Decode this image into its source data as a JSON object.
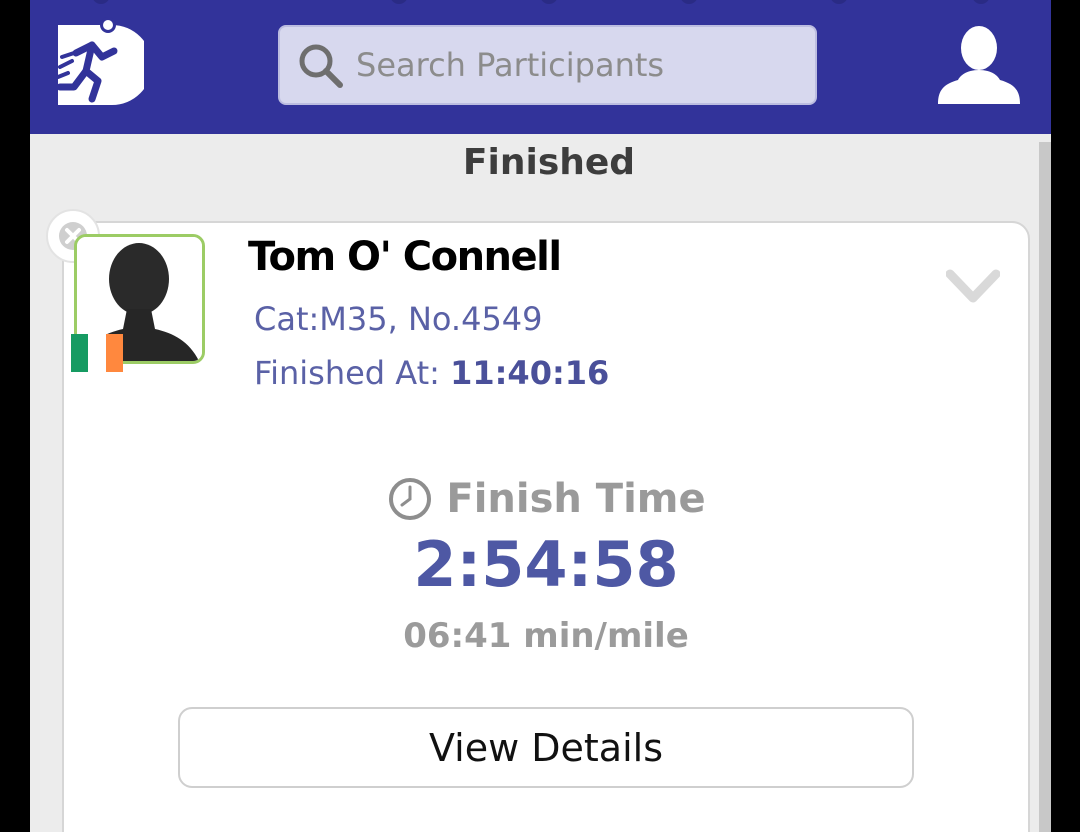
{
  "header": {
    "search": {
      "placeholder": "Search Participants",
      "value": ""
    },
    "logo_icon": "running-man-logo-icon",
    "user_icon": "user-silhouette-icon",
    "background_color": "#32339a"
  },
  "section": {
    "title": "Finished"
  },
  "participant": {
    "name": "Tom O' Connell",
    "category_line": "Cat:M35, No.4549",
    "finished_at_label": "Finished At:",
    "finished_at_value": "11:40:16",
    "flag_icon": "ireland-flag-icon",
    "flag_colors": [
      "#169b62",
      "#ffffff",
      "#ff883e"
    ]
  },
  "result": {
    "finish_time_label": "Finish Time",
    "finish_time": "2:54:58",
    "pace": "06:41 min/mile",
    "clock_icon": "clock-icon"
  },
  "actions": {
    "view_details_label": "View Details"
  },
  "colors": {
    "accent": "#4e58a4",
    "avatar_border": "#9ccc65"
  }
}
